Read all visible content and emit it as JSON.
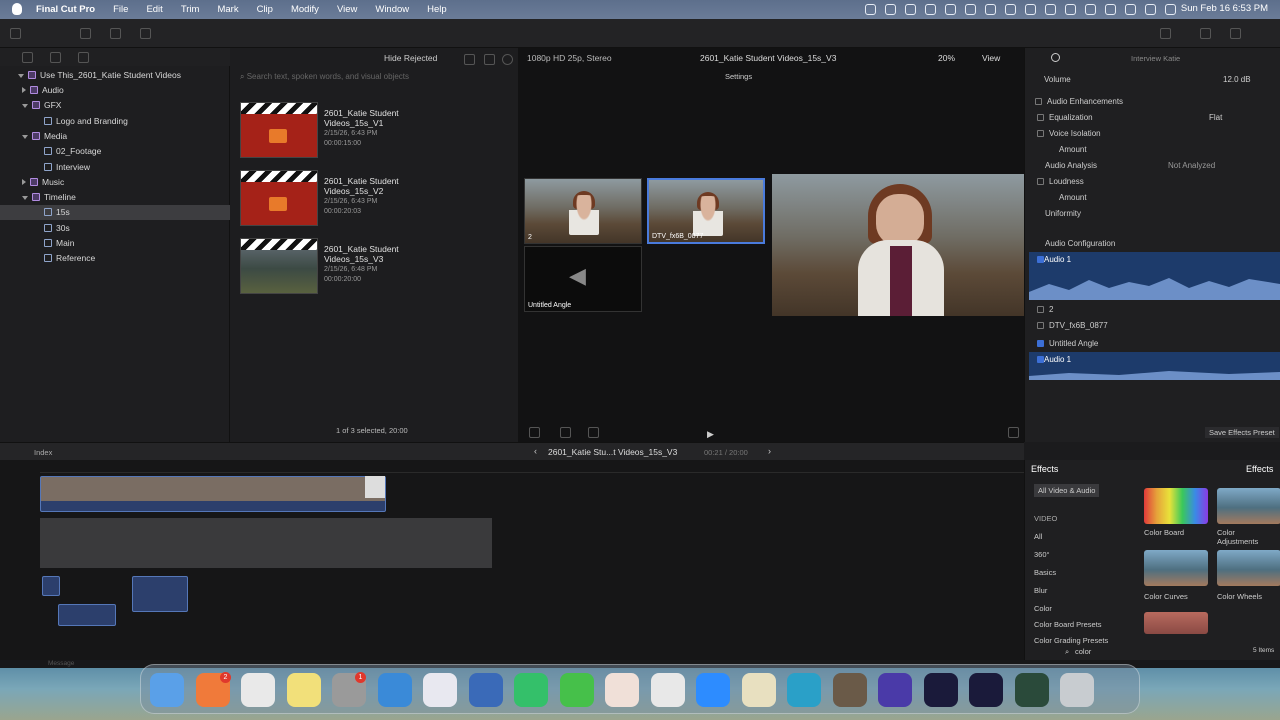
{
  "menubar": {
    "app": "Final Cut Pro",
    "items": [
      "File",
      "Edit",
      "Trim",
      "Mark",
      "Clip",
      "Modify",
      "View",
      "Window",
      "Help"
    ],
    "clock": "Sun Feb 16  6:53 PM"
  },
  "browser_header": {
    "hide_rejected": "Hide Rejected",
    "search_placeholder": "Search text, spoken words, and visual objects"
  },
  "library": {
    "root": "Use This_2601_Katie Student Videos",
    "items": [
      {
        "label": "Audio",
        "level": 1,
        "tri": "closed"
      },
      {
        "label": "GFX",
        "level": 1,
        "tri": "open"
      },
      {
        "label": "Logo and Branding",
        "level": 2,
        "tri": ""
      },
      {
        "label": "Media",
        "level": 1,
        "tri": "open"
      },
      {
        "label": "02_Footage",
        "level": 2,
        "tri": ""
      },
      {
        "label": "Interview",
        "level": 2,
        "tri": ""
      },
      {
        "label": "Music",
        "level": 1,
        "tri": "closed"
      },
      {
        "label": "Timeline",
        "level": 1,
        "tri": "open"
      },
      {
        "label": "15s",
        "level": 2,
        "tri": "",
        "selected": true
      },
      {
        "label": "30s",
        "level": 2,
        "tri": ""
      },
      {
        "label": "Main",
        "level": 2,
        "tri": ""
      },
      {
        "label": "Reference",
        "level": 2,
        "tri": ""
      }
    ]
  },
  "clips": [
    {
      "name": "2601_Katie Student Videos_15s_V1",
      "date": "2/15/26, 6:43 PM",
      "duration": "00:00:15:00",
      "kind": "gfx"
    },
    {
      "name": "2601_Katie Student Videos_15s_V2",
      "date": "2/15/26, 6:43 PM",
      "duration": "00:00:20:03",
      "kind": "gfx"
    },
    {
      "name": "2601_Katie Student Videos_15s_V3",
      "date": "2/15/26, 6:48 PM",
      "duration": "00:00:20:00",
      "kind": "video"
    }
  ],
  "selection_status": "1 of 3 selected, 20:00",
  "viewer": {
    "format": "1080p HD 25p, Stereo",
    "title": "2601_Katie Student Videos_15s_V3",
    "zoom": "20%",
    "view": "View",
    "settings": "Settings",
    "angles": [
      "2",
      "DTV_fx6B_0877",
      "Untitled Angle"
    ]
  },
  "inspector": {
    "title": "Interview Katie",
    "volume_label": "Volume",
    "volume_value": "12.0 dB",
    "enhancements": "Audio Enhancements",
    "equalization": "Equalization",
    "eq_value": "Flat",
    "voice_isolation": "Voice Isolation",
    "amount": "Amount",
    "analysis": "Audio Analysis",
    "analysis_value": "Not Analyzed",
    "loudness": "Loudness",
    "uniformity": "Uniformity",
    "config": "Audio Configuration",
    "audio1": "Audio 1",
    "two": "2",
    "dtv": "DTV_fx6B_0877",
    "untitled": "Untitled Angle",
    "audio1b": "Audio 1",
    "save_preset": "Save Effects Preset"
  },
  "timeline": {
    "index": "Index",
    "title": "2601_Katie Stu...t Videos_15s_V3",
    "timecode": "00:21 / 20:00"
  },
  "effects": {
    "title": "Effects",
    "header_right": "Effects",
    "categories": [
      "All Video & Audio",
      "VIDEO",
      "All",
      "360°",
      "Basics",
      "Blur",
      "Color",
      "Color Board Presets",
      "Color Grading Presets"
    ],
    "items": [
      "Color Board",
      "Color Adjustments",
      "Color Curves",
      "Color Wheels"
    ],
    "search": "color",
    "count": "5 Items"
  },
  "message": "Message",
  "dock_badges": [
    "2",
    "1"
  ]
}
